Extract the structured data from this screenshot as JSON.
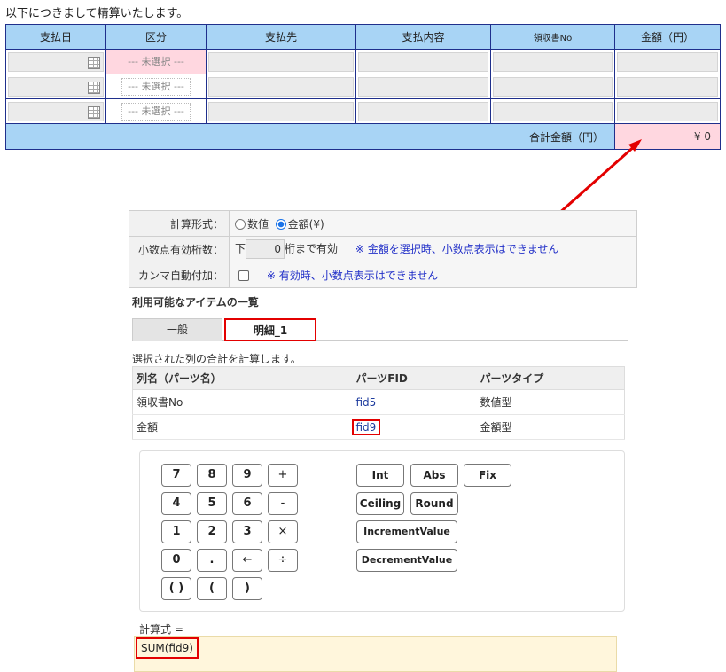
{
  "intro": "以下につきまして精算いたします。",
  "expense_table": {
    "headers": [
      "支払日",
      "区分",
      "支払先",
      "支払内容",
      "領収書No",
      "金額（円）"
    ],
    "rows": [
      {
        "category": "--- 未選択 ---"
      },
      {
        "category": "--- 未選択 ---"
      },
      {
        "category": "--- 未選択 ---"
      }
    ],
    "total_label": "合計金額（円）",
    "total_value": "¥ 0"
  },
  "settings": {
    "calc_format_label": "計算形式：",
    "radio_numeric": "数値",
    "radio_amount": "金額(¥)",
    "selected": "金額(¥)",
    "decimal_label": "小数点有効桁数：",
    "decimal_prefix": "下",
    "decimal_value": "0",
    "decimal_suffix": "桁まで有効",
    "decimal_note": "※ 金額を選択時、小数点表示はできません",
    "comma_label": "カンマ自動付加：",
    "comma_note": "※ 有効時、小数点表示はできません"
  },
  "items_heading": "利用可能なアイテムの一覧",
  "tabs": {
    "general": "一般",
    "detail": "明細_1"
  },
  "description": "選択された列の合計を計算します。",
  "columns_table": {
    "headers": [
      "列名（パーツ名）",
      "パーツFID",
      "パーツタイプ"
    ],
    "rows": [
      {
        "name": "領収書No",
        "fid": "fid5",
        "type": "数値型"
      },
      {
        "name": "金額",
        "fid": "fid9",
        "type": "金額型"
      }
    ]
  },
  "keypad": {
    "digits": [
      "7",
      "8",
      "9",
      "+",
      "4",
      "5",
      "6",
      "-",
      "1",
      "2",
      "3",
      "×",
      "0",
      ".",
      "←",
      "÷",
      "( )",
      "(",
      ")"
    ],
    "functions": [
      "Int",
      "Abs",
      "Fix",
      "Ceiling",
      "Round",
      "IncrementValue",
      "DecrementValue"
    ]
  },
  "formula_label": "計算式 =",
  "formula": "SUM(fid9)",
  "colors": {
    "header_blue": "#a8d4f5",
    "highlight_pink": "#ffd7e0",
    "annotation_red": "#e30000",
    "note_blue": "#2230c8"
  }
}
